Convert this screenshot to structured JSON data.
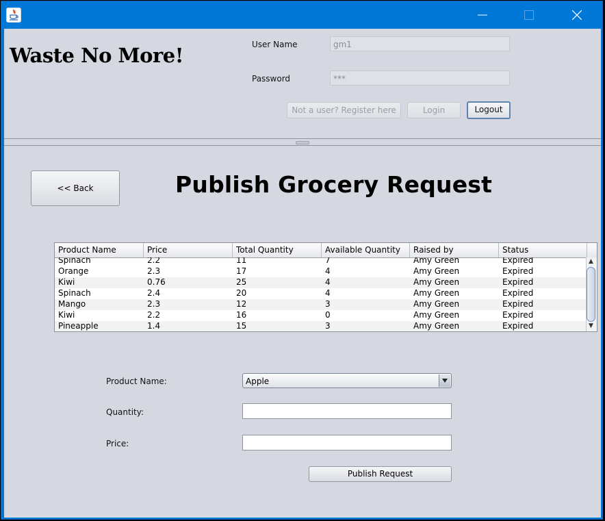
{
  "app": {
    "title": "Waste No More!"
  },
  "login": {
    "username_label": "User Name",
    "username_value": "gm1",
    "password_label": "Password",
    "password_value": "***",
    "register_label": "Not a user? Register here",
    "login_label": "Login",
    "logout_label": "Logout"
  },
  "page": {
    "back_label": "<< Back",
    "title": "Publish Grocery Request"
  },
  "table": {
    "headers": [
      "Product Name",
      "Price",
      "Total Quantity",
      "Available Quantity",
      "Raised by",
      "Status"
    ],
    "rows": [
      [
        "Spinach",
        "2.2",
        "11",
        "7",
        "Amy Green",
        "Expired"
      ],
      [
        "Orange",
        "2.3",
        "17",
        "4",
        "Amy Green",
        "Expired"
      ],
      [
        "Kiwi",
        "0.76",
        "25",
        "4",
        "Amy Green",
        "Expired"
      ],
      [
        "Spinach",
        "2.4",
        "20",
        "4",
        "Amy Green",
        "Expired"
      ],
      [
        "Mango",
        "2.3",
        "12",
        "3",
        "Amy Green",
        "Expired"
      ],
      [
        "Kiwi",
        "2.2",
        "16",
        "0",
        "Amy Green",
        "Expired"
      ],
      [
        "Pineapple",
        "1.4",
        "15",
        "3",
        "Amy Green",
        "Expired"
      ]
    ]
  },
  "form": {
    "product_label": "Product Name:",
    "product_selected": "Apple",
    "quantity_label": "Quantity:",
    "quantity_value": "",
    "price_label": "Price:",
    "price_value": "",
    "submit_label": "Publish Request"
  },
  "colors": {
    "titlebar": "#0078d7",
    "panel": "#d5d8e0"
  }
}
